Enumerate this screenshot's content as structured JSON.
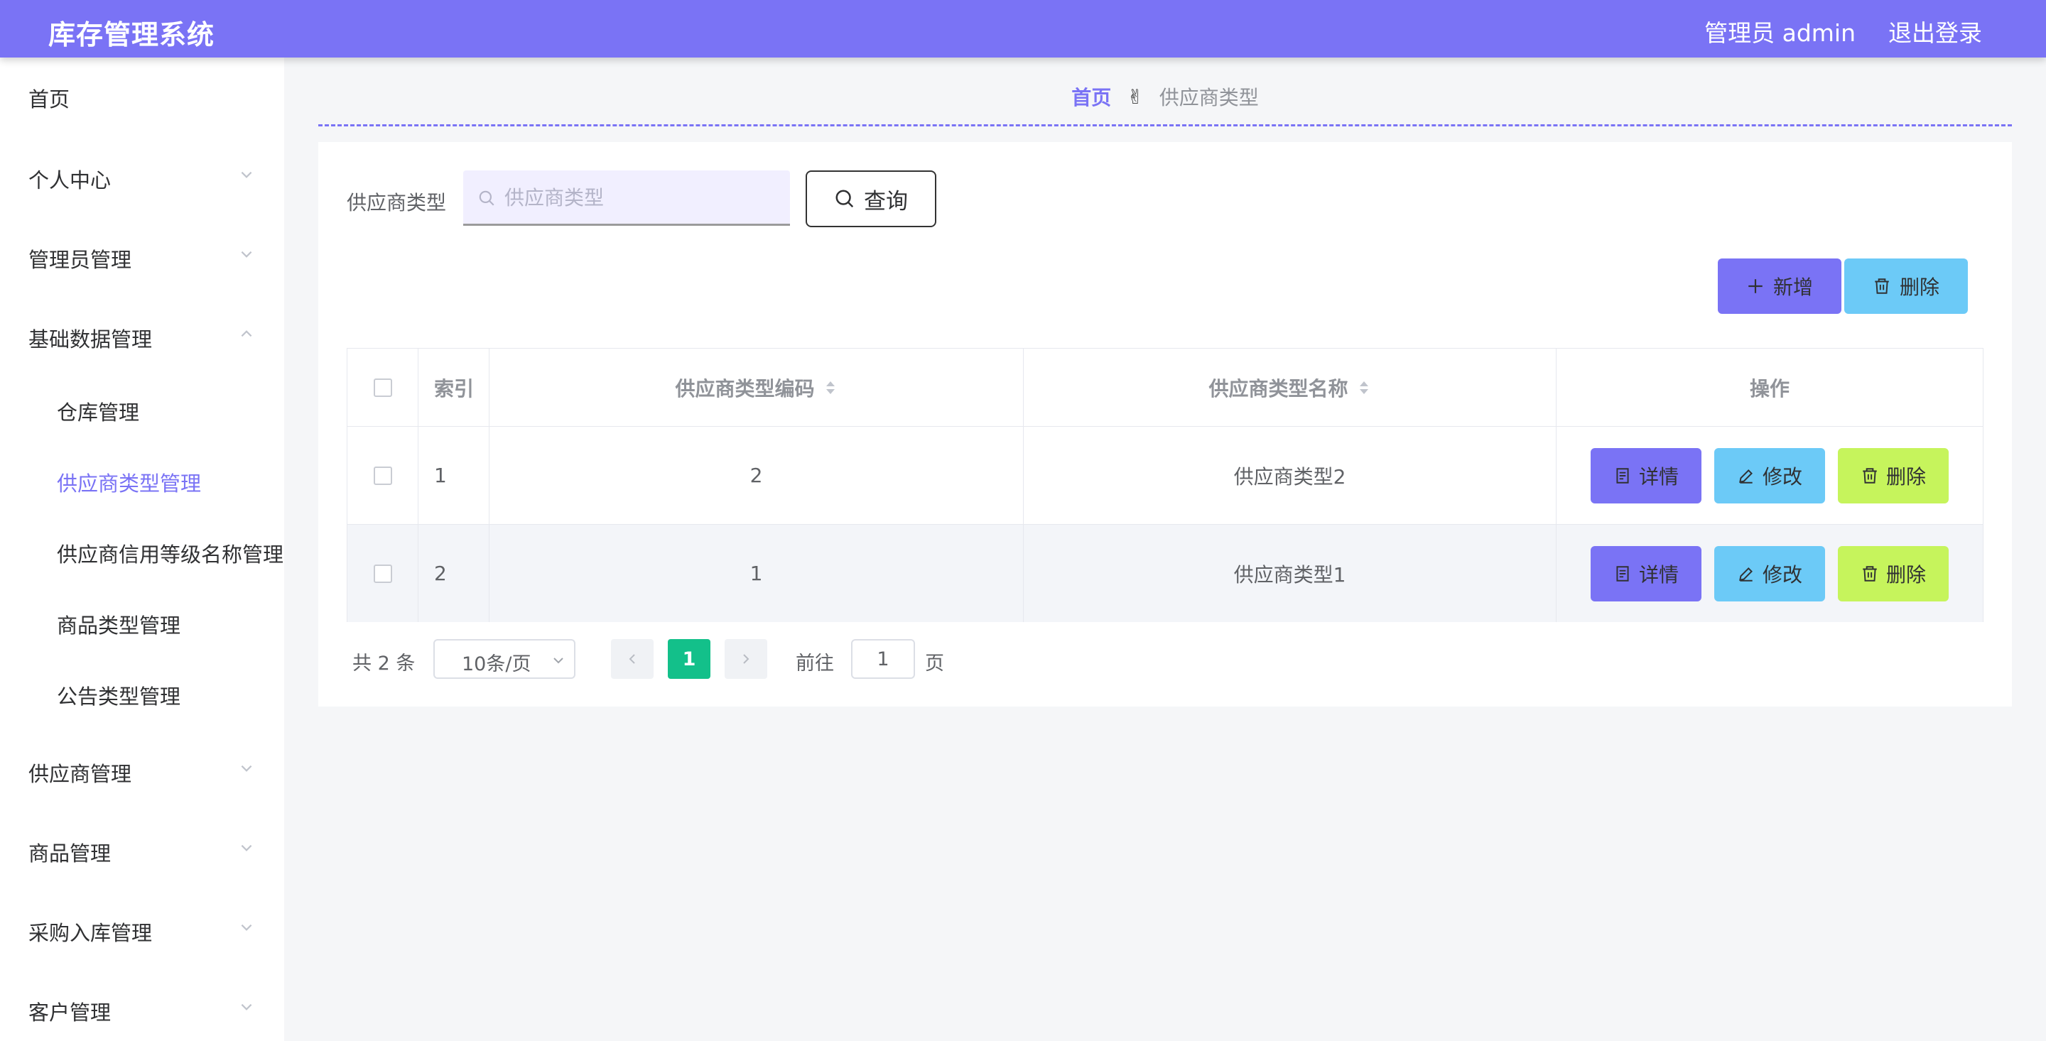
{
  "header": {
    "title": "库存管理系统",
    "admin": "管理员 admin",
    "logout": "退出登录"
  },
  "sidebar": {
    "items": [
      {
        "label": "首页"
      },
      {
        "label": "个人中心"
      },
      {
        "label": "管理员管理"
      },
      {
        "label": "基础数据管理"
      },
      {
        "label": "仓库管理"
      },
      {
        "label": "供应商类型管理"
      },
      {
        "label": "供应商信用等级名称管理"
      },
      {
        "label": "商品类型管理"
      },
      {
        "label": "公告类型管理"
      },
      {
        "label": "供应商管理"
      },
      {
        "label": "商品管理"
      },
      {
        "label": "采购入库管理"
      },
      {
        "label": "客户管理"
      }
    ]
  },
  "breadcrumb": {
    "home": "首页",
    "separator": "✌",
    "current": "供应商类型"
  },
  "search": {
    "label": "供应商类型",
    "placeholder": "供应商类型",
    "value": "",
    "button": "查询"
  },
  "toolbar": {
    "add": "新增",
    "delete": "删除"
  },
  "table": {
    "headers": {
      "index": "索引",
      "code": "供应商类型编码",
      "name": "供应商类型名称",
      "ops": "操作"
    },
    "rows": [
      {
        "index": "1",
        "code": "2",
        "name": "供应商类型2"
      },
      {
        "index": "2",
        "code": "1",
        "name": "供应商类型1"
      }
    ],
    "actions": {
      "detail": "详情",
      "edit": "修改",
      "delete": "删除"
    }
  },
  "pagination": {
    "total": "共 2 条",
    "page_size": "10条/页",
    "current_page": "1",
    "goto_label": "前往",
    "goto_value": "1",
    "page_word": "页"
  },
  "colors": {
    "primary": "#7a73f5",
    "info": "#6ccaf7",
    "lime": "#c6f45c",
    "pager_active": "#13c08a"
  }
}
